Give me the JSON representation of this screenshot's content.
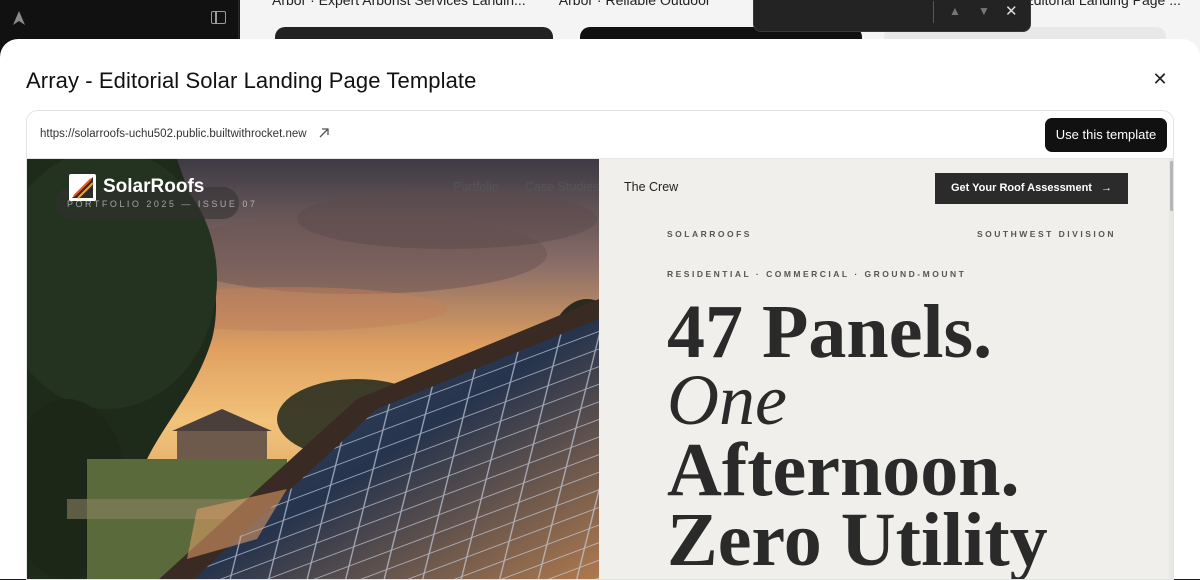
{
  "background": {
    "tabs": [
      "Arbor · Expert Arborist Services Landin...",
      "Arbor · Reliable Outdoor",
      "Editorial Landing Page ..."
    ]
  },
  "findbar": {
    "prev_icon": "chevron-up-icon",
    "next_icon": "chevron-down-icon",
    "close_label": "✕"
  },
  "modal": {
    "title": "Array - Editorial Solar Landing Page Template",
    "close_label": "✕",
    "url": "https://solarroofs-uchu502.public.builtwithrocket.new",
    "use_button_label": "Use this template"
  },
  "site": {
    "brand": "SolarRoofs",
    "issue_text": "PORTFOLIO 2025 — ISSUE 07",
    "nav": [
      "Portfolio",
      "Case Studies",
      "The Crew"
    ],
    "cta_label": "Get Your Roof Assessment",
    "cta_arrow": "→",
    "label_left": "SOLARROOFS",
    "label_right": "SOUTHWEST DIVISION",
    "categories": "RESIDENTIAL · COMMERCIAL · GROUND-MOUNT",
    "headline": [
      "47 Panels.",
      "One",
      "Afternoon.",
      "Zero Utility"
    ]
  },
  "colors": {
    "accent_dark": "#111111",
    "cta_bg": "#2b2b2b",
    "pane_bg": "#f1efeb"
  }
}
